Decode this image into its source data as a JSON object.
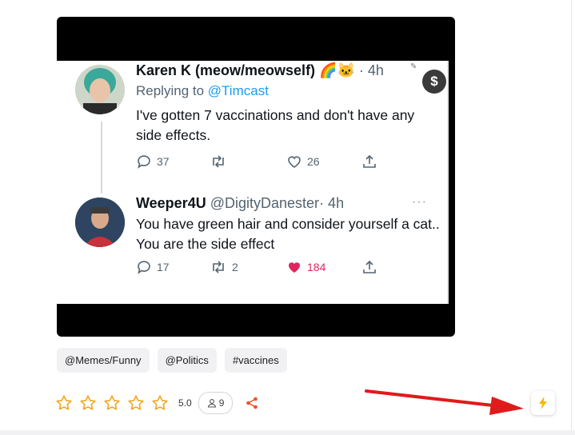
{
  "post": {
    "tweet1": {
      "name": "Karen K (meow/meowself)",
      "emojis": "🌈🐱",
      "time": "· 4h",
      "replying_prefix": "Replying to",
      "replying_handle": "@Timcast",
      "text": "I've gotten 7 vaccinations and don't have any side effects.",
      "replies": "37",
      "likes": "26"
    },
    "tweet2": {
      "name": "Weeper4U",
      "handle": "@DigityDanester",
      "time": "· 4h",
      "more": "···",
      "text": "You have green hair and consider yourself a cat.. You are the side effect",
      "replies": "17",
      "retweets": "2",
      "likes": "184"
    },
    "badge_symbol": "$"
  },
  "tags": [
    "@Memes/Funny",
    "@Politics",
    "#vaccines"
  ],
  "rating": {
    "stars_total": 5,
    "stars_filled": 0,
    "value": "5.0",
    "voters": "9"
  },
  "colors": {
    "star": "#f5a623",
    "share": "#e8542b",
    "arrow": "#e01b1b",
    "bolt": "#f5b800",
    "like_pink": "#e0245e",
    "link_blue": "#1d9bf0"
  }
}
